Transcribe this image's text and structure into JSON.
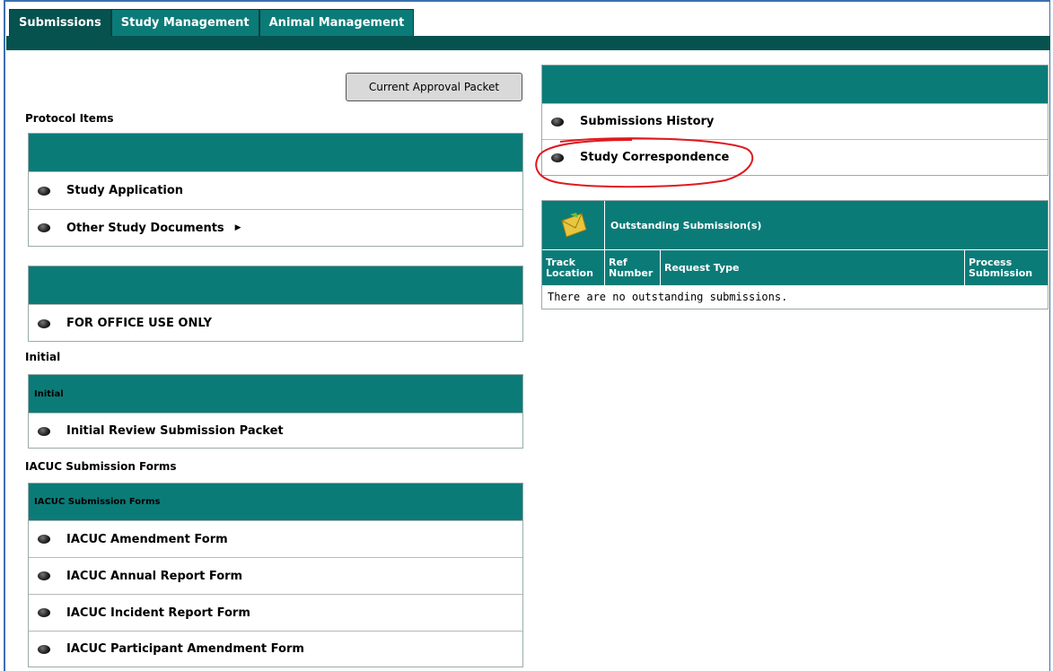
{
  "tabs": [
    {
      "label": "Submissions",
      "active": true
    },
    {
      "label": "Study Management",
      "active": false
    },
    {
      "label": "Animal Management",
      "active": false
    }
  ],
  "approval_button": "Current Approval Packet",
  "protocol": {
    "label": "Protocol Items",
    "items": [
      "Study Application",
      "Other Study Documents"
    ],
    "office_items": [
      "FOR OFFICE USE ONLY"
    ]
  },
  "initial": {
    "label": "Initial",
    "header": "Initial",
    "items": [
      "Initial Review Submission Packet"
    ]
  },
  "iacuc": {
    "label": "IACUC Submission Forms",
    "header": "IACUC Submission Forms",
    "items": [
      "IACUC Amendment Form",
      "IACUC Annual Report Form",
      "IACUC Incident Report Form",
      "IACUC Participant Amendment Form"
    ]
  },
  "right": {
    "items": [
      "Submissions History",
      "Study Correspondence"
    ]
  },
  "outstanding": {
    "title": "Outstanding Submission(s)",
    "columns": [
      "Track Location",
      "Ref Number",
      "Request Type",
      "Process Submission"
    ],
    "empty_text": "There are no outstanding submissions."
  },
  "colors": {
    "teal": "#0b7b78",
    "dark_teal": "#06524f",
    "highlight": "#e0191f"
  }
}
